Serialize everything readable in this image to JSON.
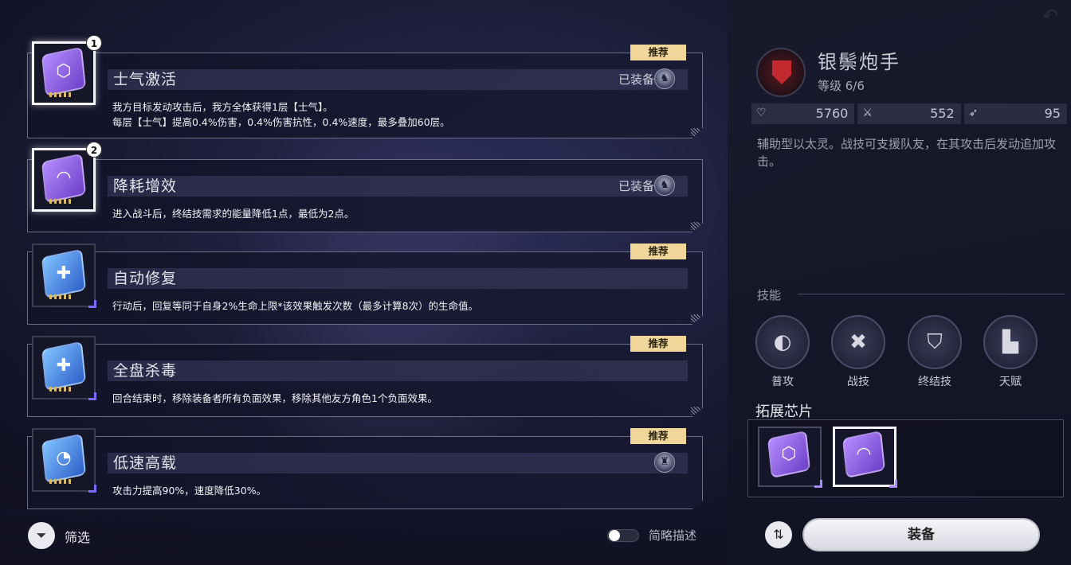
{
  "chips": [
    {
      "slot_number": "1",
      "name": "士气激活",
      "description": "我方目标发动攻击后，我方全体获得1层【士气】。\n每层【士气】提高0.4%伤害，0.4%伤害抗性，0.4%速度，最多叠加60层。",
      "recommended": "推荐",
      "equipped": "已装备",
      "icon_color": "purple",
      "icon": "badge-icon",
      "selected": true
    },
    {
      "slot_number": "2",
      "name": "降耗增效",
      "description": "进入战斗后，终结技需求的能量降低1点，最低为2点。",
      "recommended": "",
      "equipped": "已装备",
      "icon_color": "purple",
      "icon": "boost-icon",
      "selected": true
    },
    {
      "slot_number": "",
      "name": "自动修复",
      "description": "行动后，回复等同于自身2%生命上限*该效果触发次数（最多计算8次）的生命值。",
      "recommended": "推荐",
      "equipped": "",
      "icon_color": "blue",
      "icon": "heal-icon",
      "selected": false
    },
    {
      "slot_number": "",
      "name": "全盘杀毒",
      "description": "回合结束时，移除装备者所有负面效果，移除其他友方角色1个负面效果。",
      "recommended": "推荐",
      "equipped": "",
      "icon_color": "blue",
      "icon": "cleanse-icon",
      "selected": false
    },
    {
      "slot_number": "",
      "name": "低速高载",
      "description": "攻击力提高90%，速度降低30%。",
      "recommended": "推荐",
      "equipped": "",
      "icon_color": "blue",
      "icon": "speed-icon",
      "selected": false
    }
  ],
  "bottom_bar": {
    "filter_label": "筛选",
    "brief_toggle_label": "简略描述",
    "brief_toggle_on": false
  },
  "character": {
    "name": "银鬃炮手",
    "level": "等级 6/6",
    "stats": {
      "hp": "5760",
      "atk": "552",
      "spd": "95"
    },
    "description": "辅助型以太灵。战技可支援队友，在其攻击后发动追加攻击。",
    "skills_title": "技能",
    "skills": [
      {
        "label": "普攻",
        "icon": "basic-attack-icon"
      },
      {
        "label": "战技",
        "icon": "skill-icon"
      },
      {
        "label": "终结技",
        "icon": "ultimate-icon"
      },
      {
        "label": "天赋",
        "icon": "talent-icon"
      }
    ],
    "ext_chip_title": "拓展芯片"
  },
  "actions": {
    "equip_label": "装备"
  },
  "colors": {
    "recommended_tag": "#f0d799",
    "purple_chip": "#8a5ce0",
    "blue_chip": "#4a8ae6",
    "accent_corner": "#7b6cff"
  }
}
